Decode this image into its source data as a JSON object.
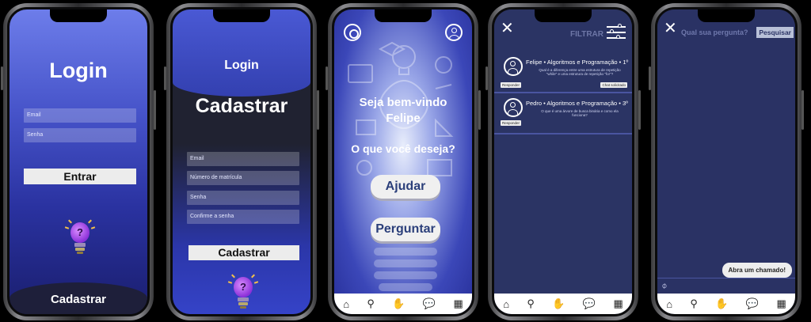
{
  "phone1": {
    "title": "Login",
    "email_placeholder": "Email",
    "password_placeholder": "Senha",
    "enter_label": "Entrar",
    "bulb_mark": "?",
    "bottom_label": "Cadastrar"
  },
  "phone2": {
    "top_label": "Login",
    "title": "Cadastrar",
    "fields": [
      "Email",
      "Número de matrícula",
      "Senha",
      "Confirme a senha"
    ],
    "submit_label": "Cadastrar",
    "bulb_mark": "?"
  },
  "phone3": {
    "welcome_line1": "Seja bem-vindo",
    "welcome_line2": "Felipe",
    "question": "O que você deseja?",
    "help_label": "Ajudar",
    "ask_label": "Perguntar",
    "icons": [
      "gear-icon",
      "user-icon"
    ]
  },
  "phone4": {
    "filter_label": "FILTRAR",
    "cards": [
      {
        "title": "Felipe • Algoritmos e Programação • 1º",
        "text": "Qual é a diferença entre uma estrutura de repetição \"while\" e uma estrutura de repetição \"for\"?",
        "reply": "Responder",
        "status": "Chat solicitado"
      },
      {
        "title": "Pedro • Algoritmos e Programação • 3º",
        "text": "O que é uma árvore de busca binária e como ela funciona?",
        "reply": "Responder",
        "status": ""
      }
    ]
  },
  "phone5": {
    "search_placeholder": "Qual sua pergunta?",
    "search_button": "Pesquisar",
    "open_ticket": "Abra um chamado!"
  },
  "nav": {
    "icons": [
      "home-icon",
      "search-icon",
      "handshake-icon",
      "chat-icon",
      "grid-icon"
    ],
    "glyphs": [
      "⌂",
      "⚲",
      "✋",
      "💬",
      "▦"
    ]
  },
  "colors": {
    "accent_blue": "#4552c8",
    "navy": "#2b3464",
    "bulb_purple": "#8b30d8"
  }
}
